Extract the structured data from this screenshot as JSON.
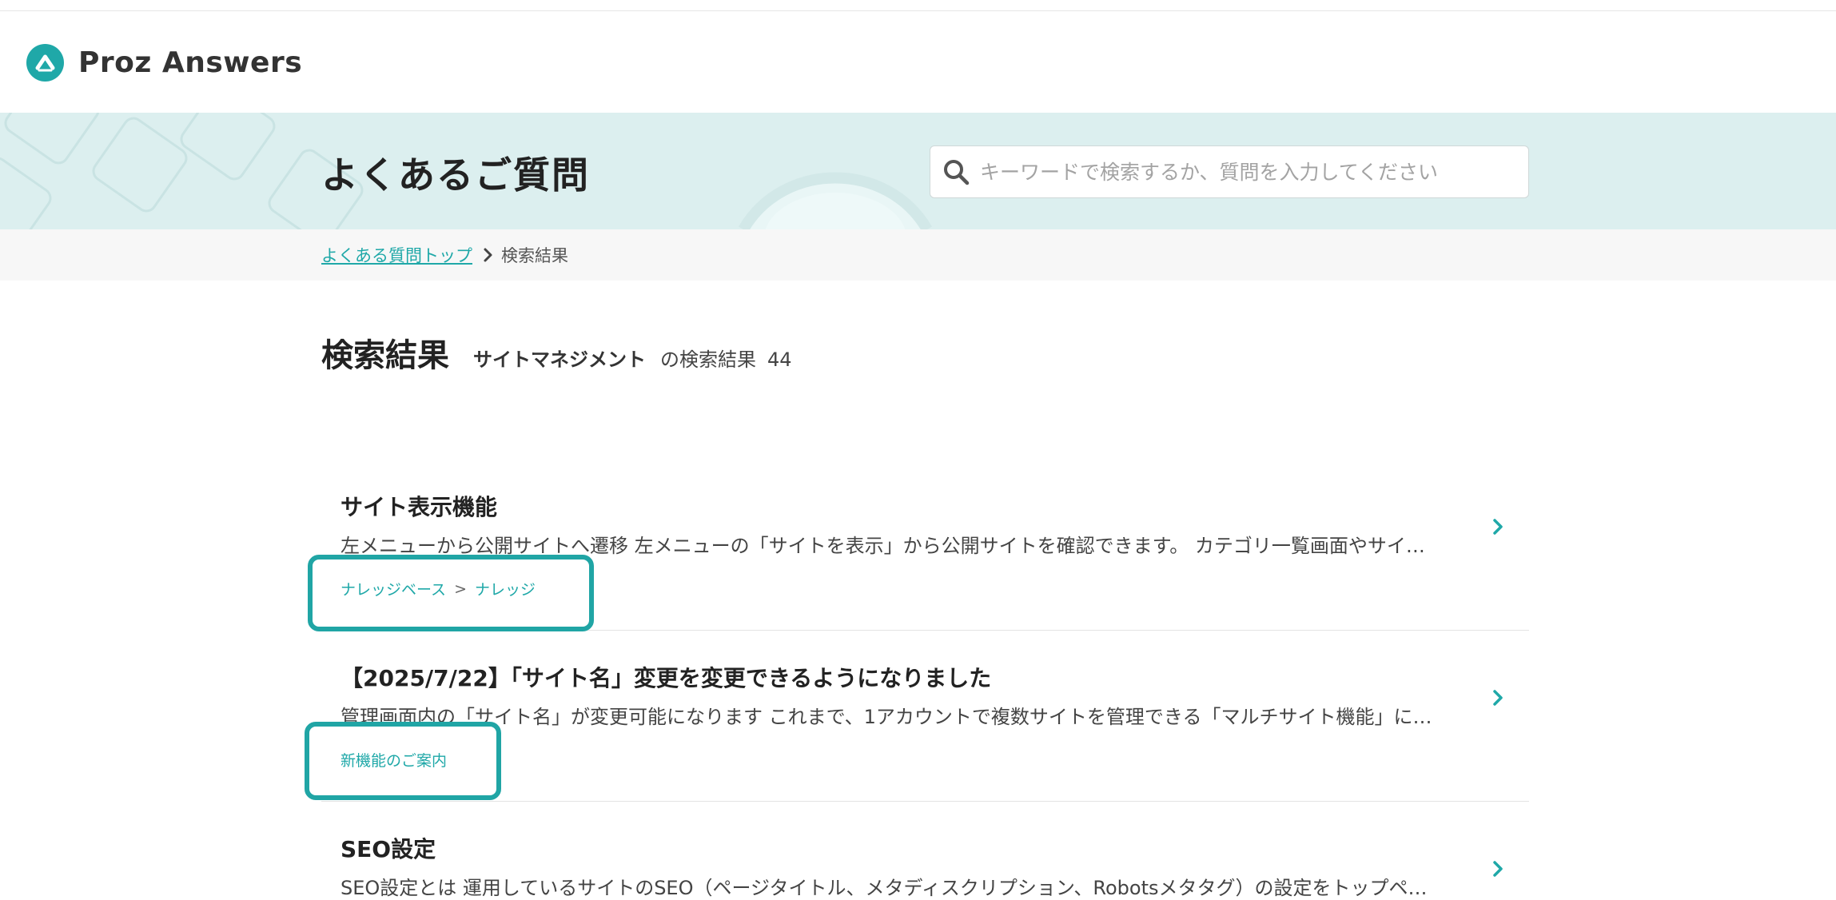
{
  "app": {
    "name": "Proz Answers",
    "logo_icon": "proz-logo-icon"
  },
  "hero": {
    "title": "よくあるご質問",
    "search_placeholder": "キーワードで検索するか、質問を入力してください",
    "search_icon": "search-icon"
  },
  "breadcrumb": {
    "home": "よくある質問トップ",
    "current": "検索結果"
  },
  "results": {
    "title": "検索結果",
    "keyword": "サイトマネジメント",
    "suffix": "の検索結果",
    "count": "44",
    "items": [
      {
        "title": "サイト表示機能",
        "excerpt": "左メニューから公開サイトへ遷移 左メニューの「サイトを表示」から公開サイトを確認できます。 カテゴリ一覧画面やサイ…",
        "category_parent": "ナレッジベース",
        "category_sep": ">",
        "category": "ナレッジ"
      },
      {
        "title": "【2025/7/22】「サイト名」変更を変更できるようになりました",
        "excerpt": "管理画面内の「サイト名」が変更可能になります これまで、1アカウントで複数サイトを管理できる「マルチサイト機能」に…",
        "category": "新機能のご案内"
      },
      {
        "title": "SEO設定",
        "excerpt": "SEO設定とは 運用しているサイトのSEO（ページタイトル、メタディスクリプション、Robotsメタタグ）の設定をトップペ…"
      }
    ]
  },
  "colors": {
    "accent": "#1fa8a8",
    "hero_bg": "#dcefef",
    "highlight": "#20a5a5"
  }
}
